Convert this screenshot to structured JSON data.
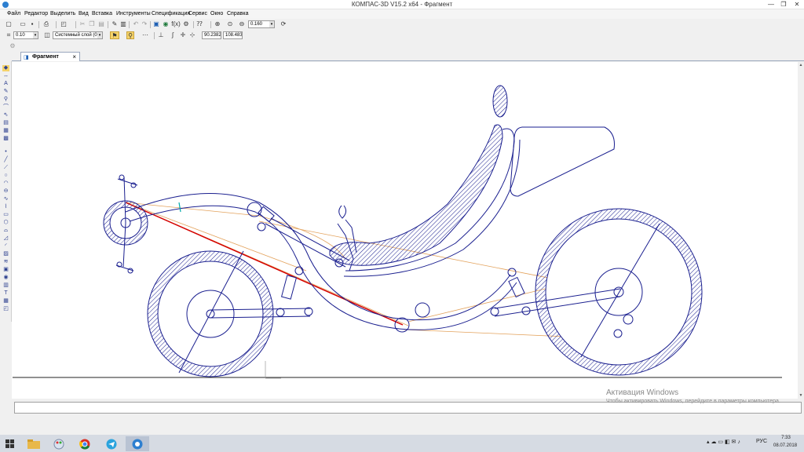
{
  "window": {
    "title": "КОМПАС-3D V15.2  x64 - Фрагмент",
    "minimize": "—",
    "restore": "❐",
    "close": "✕"
  },
  "menu": [
    "Файл",
    "Редактор",
    "Выделить",
    "Вид",
    "Вставка",
    "Инструменты",
    "Спецификация",
    "Сервис",
    "Окно",
    "Справка"
  ],
  "toolbar": {
    "zoom_value": "0.160",
    "line_step": "0.10",
    "layer": "Системный слой (0)",
    "coord_x": "90.2382",
    "coord_y": "108.483"
  },
  "document_tab": {
    "label": "Фрагмент",
    "close": "×"
  },
  "watermark": {
    "title": "Активация Windows",
    "text": "Чтобы активировать Windows, перейдите в параметры компьютера."
  },
  "tray": {
    "language": "РУС",
    "time": "7:33",
    "date": "08.07.2018"
  },
  "colors": {
    "drawing_primary": "#1a1f8f",
    "construction_line": "#e3a25c",
    "highlight_line": "#d40000"
  },
  "icons": {
    "app": "kompas-logo-icon",
    "new": "new-document-icon",
    "open": "open-folder-icon",
    "save": "save-icon",
    "print": "print-icon",
    "zoom": "magnifier-icon"
  }
}
